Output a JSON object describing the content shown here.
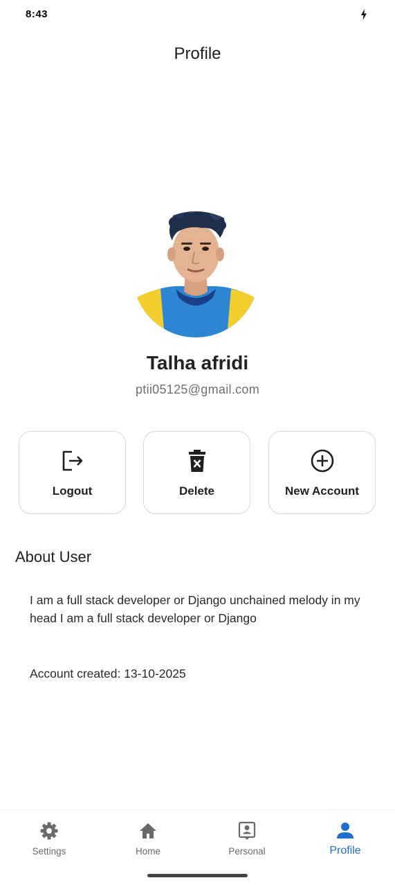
{
  "status_bar": {
    "time": "8:43",
    "charging_icon": "bolt-icon"
  },
  "app_bar": {
    "title": "Profile"
  },
  "profile": {
    "avatar_icon": "user-photo",
    "name": "Talha afridi",
    "email": "ptii05125@gmail.com"
  },
  "actions": [
    {
      "label": "Logout",
      "icon": "logout-icon"
    },
    {
      "label": "Delete",
      "icon": "trash-icon"
    },
    {
      "label": "New Account",
      "icon": "add-circle-icon"
    }
  ],
  "about": {
    "heading": "About User",
    "text": "I am a full stack developer or Django unchained melody in my head I am a full stack developer or Django",
    "created": "Account created: 13-10-2025"
  },
  "bottom_nav": {
    "items": [
      {
        "label": "Settings",
        "icon": "gear-icon",
        "active": false
      },
      {
        "label": "Home",
        "icon": "home-icon",
        "active": false
      },
      {
        "label": "Personal",
        "icon": "id-badge-icon",
        "active": false
      },
      {
        "label": "Profile",
        "icon": "person-icon",
        "active": true
      }
    ]
  },
  "colors": {
    "accent": "#1f6fd0",
    "text": "#1f1f1f",
    "muted": "#6f6f6f",
    "border": "#d6d6d6"
  }
}
